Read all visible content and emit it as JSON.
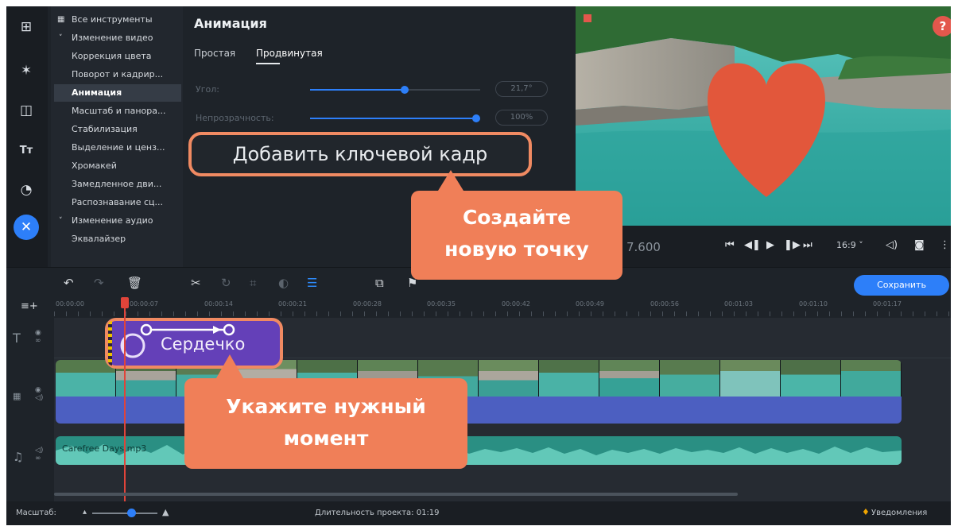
{
  "sidebar_icons": [
    "import-icon",
    "magic-wand-icon",
    "transitions-icon",
    "titles-icon",
    "stickers-icon",
    "tools-icon"
  ],
  "tools": {
    "all_tools": "Все инструменты",
    "video_group": "Изменение видео",
    "items": [
      "Коррекция цвета",
      "Поворот и кадрир...",
      "Анимация",
      "Масштаб и панора...",
      "Стабилизация",
      "Выделение и ценз...",
      "Хромакей",
      "Замедленное дви...",
      "Распознавание сц..."
    ],
    "selected": "Анимация",
    "audio_group": "Изменение аудио",
    "audio_items": [
      "Эквалайзер"
    ]
  },
  "panel": {
    "title": "Анимация",
    "tabs": [
      "Простая",
      "Продвинутая"
    ],
    "active_tab": "Продвинутая",
    "params": [
      {
        "label": "Угол:",
        "value": "21,7°",
        "level": 0.56
      },
      {
        "label": "Непрозрачность:",
        "value": "100%",
        "level": 1.0
      }
    ],
    "add_keyframe_label": "Добавить ключевой кадр"
  },
  "preview": {
    "help_label": "?",
    "timecode": "7.600",
    "aspect_ratio": "16:9 ˅"
  },
  "toolbar": {
    "save_label": "Сохранить"
  },
  "ruler": {
    "ticks": [
      "00:00:00",
      "00:00:07",
      "00:00:14",
      "00:00:21",
      "00:00:28",
      "00:00:35",
      "00:00:42",
      "00:00:49",
      "00:00:56",
      "00:01:03",
      "00:01:10",
      "00:01:17"
    ]
  },
  "timeline": {
    "title_clip_label": "Сердечко",
    "audio_clip_label": "Carefree Days.mp3"
  },
  "status": {
    "zoom_label": "Масштаб:",
    "duration": "Длительность проекта: 01:19",
    "notifications": "Уведомления"
  },
  "callouts": {
    "create_point": "Создайте\nновую точку",
    "set_moment": "Укажите нужный\nмомент"
  },
  "colors": {
    "accent": "#2d7ff9",
    "callout": "#f07f58",
    "heart": "#e2573b",
    "title_clip": "#6440b8",
    "video_track": "#4c5fc1",
    "audio_track": "#2a8f83"
  }
}
